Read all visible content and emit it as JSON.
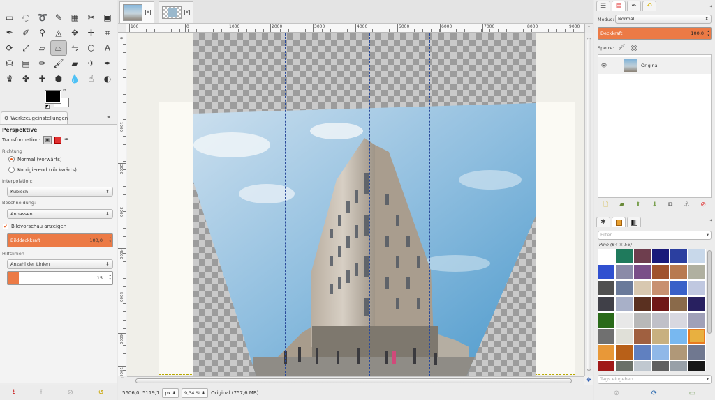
{
  "toolbox": {
    "tools": [
      {
        "icon": "rect-select-icon",
        "glyph": "▭"
      },
      {
        "icon": "ellipse-select-icon",
        "glyph": "◌"
      },
      {
        "icon": "free-select-icon",
        "glyph": "➰"
      },
      {
        "icon": "fuzzy-select-icon",
        "glyph": "✎"
      },
      {
        "icon": "select-by-color-icon",
        "glyph": "▦"
      },
      {
        "icon": "scissors-select-icon",
        "glyph": "✂"
      },
      {
        "icon": "foreground-select-icon",
        "glyph": "▣"
      },
      {
        "icon": "paths-icon",
        "glyph": "✒"
      },
      {
        "icon": "color-picker-icon",
        "glyph": "✐"
      },
      {
        "icon": "zoom-icon",
        "glyph": "⚲"
      },
      {
        "icon": "measure-icon",
        "glyph": "◬"
      },
      {
        "icon": "move-icon",
        "glyph": "✥"
      },
      {
        "icon": "align-icon",
        "glyph": "✛"
      },
      {
        "icon": "crop-icon",
        "glyph": "⌗"
      },
      {
        "icon": "rotate-icon",
        "glyph": "⟳"
      },
      {
        "icon": "scale-icon",
        "glyph": "⤢"
      },
      {
        "icon": "shear-icon",
        "glyph": "▱"
      },
      {
        "icon": "perspective-icon",
        "glyph": "⏢"
      },
      {
        "icon": "flip-icon",
        "glyph": "⇋"
      },
      {
        "icon": "cage-icon",
        "glyph": "⬡"
      },
      {
        "icon": "text-icon",
        "glyph": "A"
      },
      {
        "icon": "bucket-fill-icon",
        "glyph": "⛁"
      },
      {
        "icon": "blend-icon",
        "glyph": "▤"
      },
      {
        "icon": "pencil-icon",
        "glyph": "✏"
      },
      {
        "icon": "paintbrush-icon",
        "glyph": "🖌"
      },
      {
        "icon": "eraser-icon",
        "glyph": "▰"
      },
      {
        "icon": "airbrush-icon",
        "glyph": "✈"
      },
      {
        "icon": "ink-icon",
        "glyph": "✒"
      },
      {
        "icon": "mypaint-brush-icon",
        "glyph": "♛"
      },
      {
        "icon": "clone-icon",
        "glyph": "✤"
      },
      {
        "icon": "heal-icon",
        "glyph": "✚"
      },
      {
        "icon": "perspective-clone-icon",
        "glyph": "⬢"
      },
      {
        "icon": "blur-icon",
        "glyph": "💧"
      },
      {
        "icon": "smudge-icon",
        "glyph": "☝"
      },
      {
        "icon": "dodge-burn-icon",
        "glyph": "◐"
      }
    ],
    "active_tool_index": 17
  },
  "tool_options": {
    "tab_label": "Werkzeugeinstellungen",
    "title": "Perspektive",
    "transformation_label": "Transformation:",
    "direction_label": "Richtung",
    "direction_options": [
      "Normal (vorwärts)",
      "Korrigierend (rückwärts)"
    ],
    "direction_selected": 0,
    "interpolation_label": "Interpolation:",
    "interpolation_value": "Kubisch",
    "clipping_label": "Beschneidung:",
    "clipping_value": "Anpassen",
    "preview_label": "Bildvorschau anzeigen",
    "preview_checked": true,
    "opacity_label": "Bilddeckkraft",
    "opacity_value": "100,0",
    "opacity_fraction": 1.0,
    "guides_label": "Hilfslinien",
    "guides_value": "Anzahl der Linien",
    "lines_count": "15"
  },
  "image_tabs": [
    {
      "thumb": "building-photo-thumb",
      "active": true
    },
    {
      "thumb": "checker-photo-thumb",
      "active": false
    }
  ],
  "ruler": {
    "top_labels": [
      "100",
      "0",
      "1000",
      "2000",
      "3000",
      "4000",
      "5000",
      "6000",
      "7000",
      "8000",
      "9000"
    ],
    "left_labels": [
      "9",
      "1000",
      "2000",
      "3000",
      "4000",
      "5000",
      "6000",
      "7000"
    ]
  },
  "status": {
    "coords": "5606,0, 5119,1",
    "unit": "px",
    "zoom": "9,34 %",
    "info": "Original (757,6 MB)"
  },
  "layers": {
    "mode_label": "Modus:",
    "mode_value": "Normal",
    "opacity_label": "Deckkraft",
    "opacity_value": "100,0",
    "lock_label": "Sperre:",
    "items": [
      {
        "name": "Original",
        "visible": true
      }
    ]
  },
  "patterns": {
    "filter_placeholder": "Filter",
    "title": "Pine (64 × 56)",
    "tags_placeholder": "Tags eingeben",
    "colors": [
      "#ffffff",
      "#1f7a5c",
      "#6e3e4e",
      "#1a1a7a",
      "#2b3fa0",
      "#c8d8ea",
      "#3050d0",
      "#8a8aa8",
      "#7a4e88",
      "#a0522d",
      "#b87a50",
      "#b0b0a0",
      "#505050",
      "#6a7a9a",
      "#d8c8b0",
      "#c89070",
      "#3860c8",
      "#c0c8e0",
      "#404048",
      "#a8b0c8",
      "#5a3020",
      "#701818",
      "#8a6a4a",
      "#282060",
      "#2a6a1a",
      "#e8e8e8",
      "#b8b8b8",
      "#c0c0c8",
      "#d8d8e0",
      "#a0a0b8",
      "#707070",
      "#e0e0d8",
      "#a06040",
      "#c8b080",
      "#78b8f0",
      "#e8b040",
      "#e89838",
      "#b86018",
      "#6080c0",
      "#90b8e8",
      "#b09878",
      "#707890",
      "#a01818",
      "#6a7068",
      "#c0c8d0",
      "#606060",
      "#98a0a8",
      "#181818"
    ],
    "selected_index": 35
  }
}
